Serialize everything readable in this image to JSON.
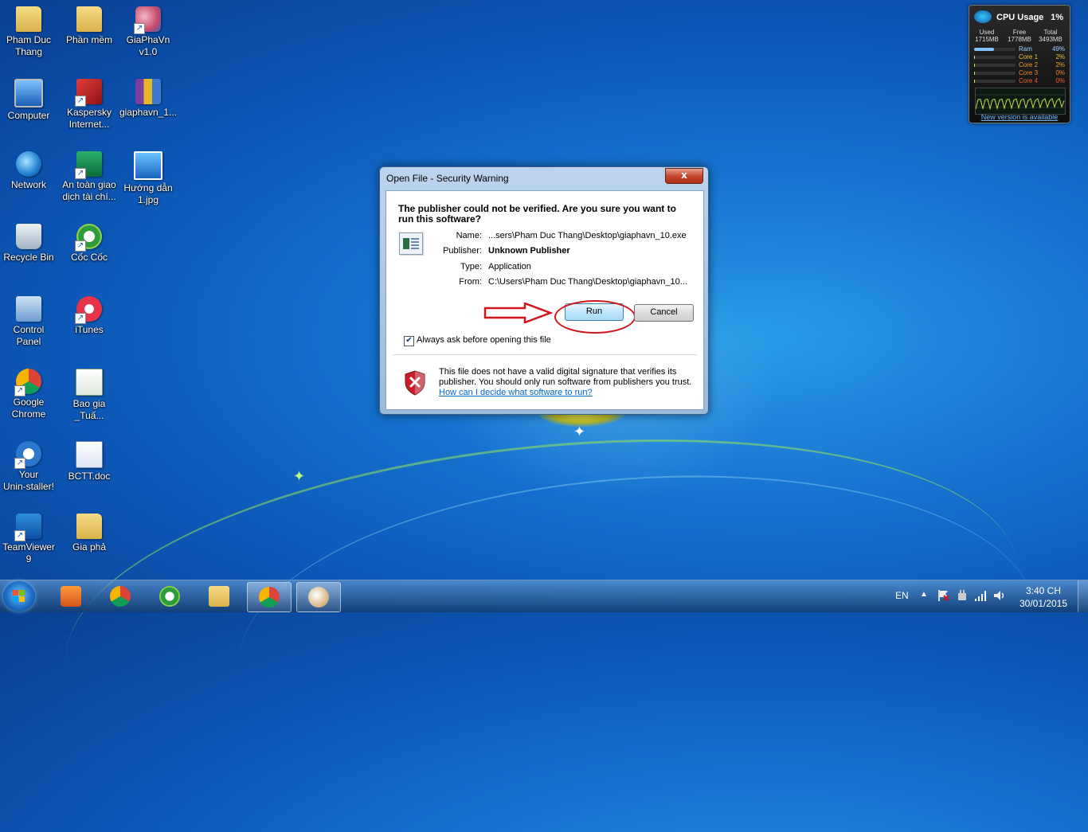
{
  "desktop": {
    "icons": [
      {
        "label": "Pham Duc\nThang",
        "icon": "user-folder-icon"
      },
      {
        "label": "Phần mềm",
        "icon": "folder-icon"
      },
      {
        "label": "GiaPhaVn\nv1.0",
        "icon": "giaphavn-icon"
      },
      {
        "label": "Computer",
        "icon": "computer-icon"
      },
      {
        "label": "Kaspersky\nInternet...",
        "icon": "kaspersky-icon"
      },
      {
        "label": "giaphavn_1...",
        "icon": "winrar-icon"
      },
      {
        "label": "Network",
        "icon": "network-icon"
      },
      {
        "label": "An toàn giao\ndịch tài chí...",
        "icon": "safe-money-icon"
      },
      {
        "label": "Hướng dẫn\n1.jpg",
        "icon": "image-file-icon"
      },
      {
        "label": "Recycle Bin",
        "icon": "recycle-bin-icon"
      },
      {
        "label": "Cốc Cốc",
        "icon": "coccoc-icon"
      },
      {
        "label": "Control\nPanel",
        "icon": "control-panel-icon"
      },
      {
        "label": "iTunes",
        "icon": "itunes-icon"
      },
      {
        "label": "Google\nChrome",
        "icon": "chrome-icon"
      },
      {
        "label": "Bao gia\n_Tuấ...",
        "icon": "excel-icon"
      },
      {
        "label": "Your\nUnin-staller!",
        "icon": "uninstaller-icon"
      },
      {
        "label": "BCTT.doc",
        "icon": "word-icon"
      },
      {
        "label": "TeamViewer\n9",
        "icon": "teamviewer-icon"
      },
      {
        "label": "Gia phả",
        "icon": "folder-icon"
      }
    ]
  },
  "gadget": {
    "title": "CPU Usage",
    "percent": "1%",
    "used_label": "Used",
    "used_value": "1715MB",
    "free_label": "Free",
    "free_value": "1778MB",
    "total_label": "Total",
    "total_value": "3493MB",
    "rows": [
      {
        "label": "Ram",
        "value": "49%",
        "level": 0.49
      },
      {
        "label": "Core 1",
        "value": "2%",
        "level": 0.02
      },
      {
        "label": "Core 2",
        "value": "2%",
        "level": 0.02
      },
      {
        "label": "Core 3",
        "value": "0%",
        "level": 0.0
      },
      {
        "label": "Core 4",
        "value": "0%",
        "level": 0.0
      }
    ],
    "link": "New version is available"
  },
  "dialog": {
    "title": "Open File - Security Warning",
    "close_label": "x",
    "question": "The publisher could not be verified.  Are you sure you want to run this software?",
    "name_label": "Name:",
    "name_value": "...sers\\Pham Duc Thang\\Desktop\\giaphavn_10.exe",
    "publisher_label": "Publisher:",
    "publisher_value": "Unknown Publisher",
    "type_label": "Type:",
    "type_value": "Application",
    "from_label": "From:",
    "from_value": "C:\\Users\\Pham Duc Thang\\Desktop\\giaphavn_10...",
    "run_label": "Run",
    "cancel_label": "Cancel",
    "always_ask_label": "Always ask before opening this file",
    "always_ask_checked": true,
    "warning_text": "This file does not have a valid digital signature that verifies its publisher.  You should only run software from publishers you trust.",
    "warning_link": "How can I decide what software to run?"
  },
  "taskbar": {
    "apps": [
      "media-player-icon",
      "chrome-icon",
      "coccoc-icon",
      "explorer-icon",
      "chrome-icon",
      "paint-icon"
    ],
    "language": "EN",
    "time": "3:40 CH",
    "date": "30/01/2015"
  }
}
